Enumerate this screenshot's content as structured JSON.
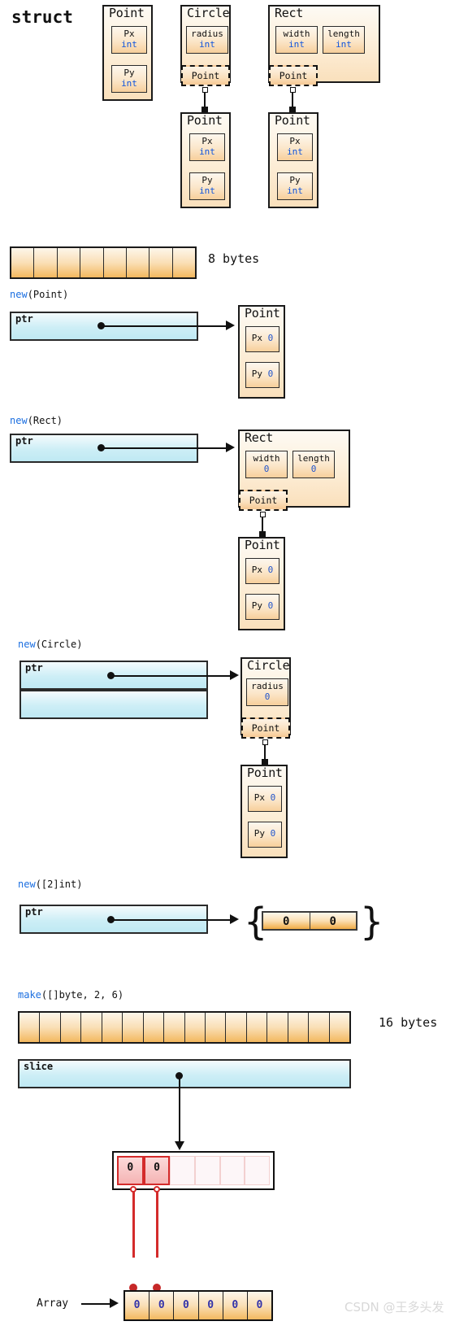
{
  "title": "struct",
  "struct_section": {
    "point": {
      "name": "Point",
      "fields": [
        {
          "name": "Px",
          "type": "int"
        },
        {
          "name": "Py",
          "type": "int"
        }
      ]
    },
    "circle": {
      "name": "Circle",
      "fields": [
        {
          "name": "radius",
          "type": "int"
        }
      ],
      "embedded": "Point"
    },
    "rect": {
      "name": "Rect",
      "fields": [
        {
          "name": "width",
          "type": "int"
        },
        {
          "name": "length",
          "type": "int"
        }
      ],
      "embedded": "Point"
    },
    "circle_point": {
      "name": "Point",
      "fields": [
        {
          "name": "Px",
          "type": "int"
        },
        {
          "name": "Py",
          "type": "int"
        }
      ]
    },
    "rect_point": {
      "name": "Point",
      "fields": [
        {
          "name": "Px",
          "type": "int"
        },
        {
          "name": "Py",
          "type": "int"
        }
      ]
    }
  },
  "bytes8": {
    "cells": 8,
    "label": "8 bytes"
  },
  "new_point": {
    "caption_kw": "new",
    "caption_rest": "(Point)",
    "ptr_label": "ptr",
    "target": {
      "name": "Point",
      "fields": [
        {
          "name": "Px",
          "value": "0"
        },
        {
          "name": "Py",
          "value": "0"
        }
      ]
    }
  },
  "new_rect": {
    "caption_kw": "new",
    "caption_rest": "(Rect)",
    "ptr_label": "ptr",
    "target": {
      "name": "Rect",
      "fields": [
        {
          "name": "width",
          "value": "0"
        },
        {
          "name": "length",
          "value": "0"
        }
      ],
      "embedded": "Point"
    },
    "embedded_target": {
      "name": "Point",
      "fields": [
        {
          "name": "Px",
          "value": "0"
        },
        {
          "name": "Py",
          "value": "0"
        }
      ]
    }
  },
  "new_circle": {
    "caption_kw": "new",
    "caption_rest": "(Circle)",
    "ptr_label": "ptr",
    "target": {
      "name": "Circle",
      "fields": [
        {
          "name": "radius",
          "value": "0"
        }
      ],
      "embedded": "Point"
    },
    "embedded_target": {
      "name": "Point",
      "fields": [
        {
          "name": "Px",
          "value": "0"
        },
        {
          "name": "Py",
          "value": "0"
        }
      ]
    }
  },
  "new_arr2": {
    "caption_kw": "new",
    "caption_rest": "([2]int)",
    "ptr_label": "ptr",
    "brace_open": "{",
    "brace_close": "}",
    "values": [
      "0",
      "0"
    ]
  },
  "make_slice": {
    "caption_kw": "make",
    "caption_rest": "([]byte, 2, 6)",
    "bytes16_cells": 16,
    "bytes16_label": "16 bytes",
    "slice_label": "slice",
    "capacity_cells": 6,
    "length_values": [
      "0",
      "0"
    ],
    "array_label": "Array",
    "array_values": [
      "0",
      "0",
      "0",
      "0",
      "0",
      "0"
    ]
  },
  "watermark": "CSDN @王多头发",
  "colors": {
    "struct_border": "#1a1a1a",
    "type_text": "#1155dd",
    "keyword": "#1c6fe0",
    "pointer_fill": "#cdeef6",
    "byte_fill": "#f3b85f",
    "slice_used": "#d42b2b"
  }
}
